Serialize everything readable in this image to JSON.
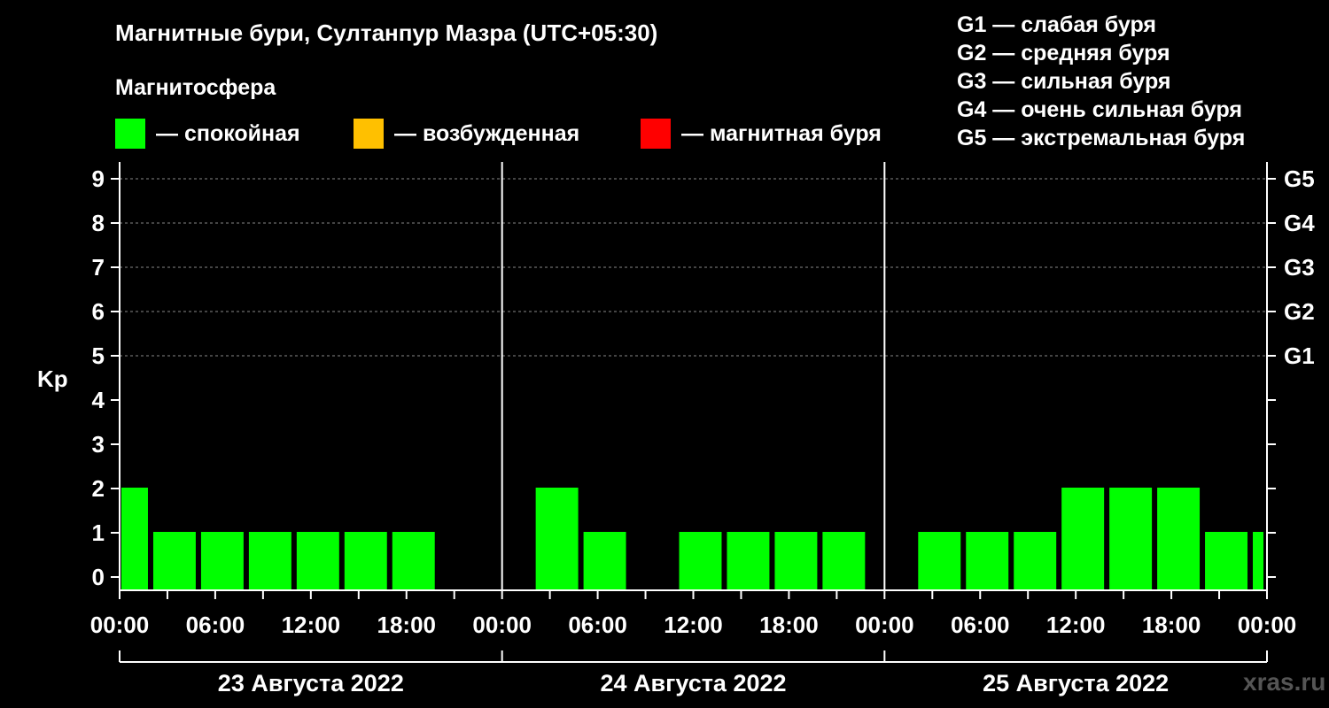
{
  "chart_data": {
    "type": "bar",
    "title": "Магнитные бури, Султанпур Мазра (UTC+05:30)",
    "ylabel": "Kp",
    "ylim": [
      0,
      9
    ],
    "y_ticks": [
      "0",
      "1",
      "2",
      "3",
      "4",
      "5",
      "6",
      "7",
      "8",
      "9"
    ],
    "right_ticks": [
      {
        "y": 5,
        "label": "G1"
      },
      {
        "y": 6,
        "label": "G2"
      },
      {
        "y": 7,
        "label": "G3"
      },
      {
        "y": 8,
        "label": "G4"
      },
      {
        "y": 9,
        "label": "G5"
      }
    ],
    "grid": "dashed horizontal at Kp 5–9",
    "x_tick_labels": [
      "00:00",
      "06:00",
      "12:00",
      "18:00",
      "00:00",
      "06:00",
      "12:00",
      "18:00",
      "00:00",
      "06:00",
      "12:00",
      "18:00",
      "00:00"
    ],
    "days": [
      "23 Августа 2022",
      "24 Августа 2022",
      "25 Августа 2022"
    ],
    "bar_color": "#00ff00",
    "series": [
      {
        "day": 0,
        "start_hour": 0,
        "duration_hours": 2,
        "kp": 2
      },
      {
        "day": 0,
        "start_hour": 2,
        "duration_hours": 3,
        "kp": 1
      },
      {
        "day": 0,
        "start_hour": 5,
        "duration_hours": 3,
        "kp": 1
      },
      {
        "day": 0,
        "start_hour": 8,
        "duration_hours": 3,
        "kp": 1
      },
      {
        "day": 0,
        "start_hour": 11,
        "duration_hours": 3,
        "kp": 1
      },
      {
        "day": 0,
        "start_hour": 14,
        "duration_hours": 3,
        "kp": 1
      },
      {
        "day": 0,
        "start_hour": 17,
        "duration_hours": 3,
        "kp": 1
      },
      {
        "day": 0,
        "start_hour": 20,
        "duration_hours": 3,
        "kp": 0
      },
      {
        "day": 0,
        "start_hour": 23,
        "duration_hours": 3,
        "kp": 0
      },
      {
        "day": 1,
        "start_hour": 2,
        "duration_hours": 3,
        "kp": 2
      },
      {
        "day": 1,
        "start_hour": 5,
        "duration_hours": 3,
        "kp": 1
      },
      {
        "day": 1,
        "start_hour": 8,
        "duration_hours": 3,
        "kp": 0
      },
      {
        "day": 1,
        "start_hour": 11,
        "duration_hours": 3,
        "kp": 1
      },
      {
        "day": 1,
        "start_hour": 14,
        "duration_hours": 3,
        "kp": 1
      },
      {
        "day": 1,
        "start_hour": 17,
        "duration_hours": 3,
        "kp": 1
      },
      {
        "day": 1,
        "start_hour": 20,
        "duration_hours": 3,
        "kp": 1
      },
      {
        "day": 1,
        "start_hour": 23,
        "duration_hours": 3,
        "kp": 0
      },
      {
        "day": 2,
        "start_hour": 2,
        "duration_hours": 3,
        "kp": 1
      },
      {
        "day": 2,
        "start_hour": 5,
        "duration_hours": 3,
        "kp": 1
      },
      {
        "day": 2,
        "start_hour": 8,
        "duration_hours": 3,
        "kp": 1
      },
      {
        "day": 2,
        "start_hour": 11,
        "duration_hours": 3,
        "kp": 2
      },
      {
        "day": 2,
        "start_hour": 14,
        "duration_hours": 3,
        "kp": 2
      },
      {
        "day": 2,
        "start_hour": 17,
        "duration_hours": 3,
        "kp": 2
      },
      {
        "day": 2,
        "start_hour": 20,
        "duration_hours": 3,
        "kp": 1
      },
      {
        "day": 2,
        "start_hour": 23,
        "duration_hours": 1,
        "kp": 1
      }
    ]
  },
  "legend": {
    "title": "Магнитосфера",
    "items": [
      {
        "label": "— спокойная",
        "color": "#00ff00"
      },
      {
        "label": "— возбужденная",
        "color": "#ffc000"
      },
      {
        "label": "— магнитная буря",
        "color": "#ff0000"
      }
    ]
  },
  "g_scale": [
    "G1 — слабая буря",
    "G2 — средняя буря",
    "G3 — сильная буря",
    "G4 — очень сильная буря",
    "G5 — экстремальная буря"
  ],
  "watermark": "xras.ru"
}
